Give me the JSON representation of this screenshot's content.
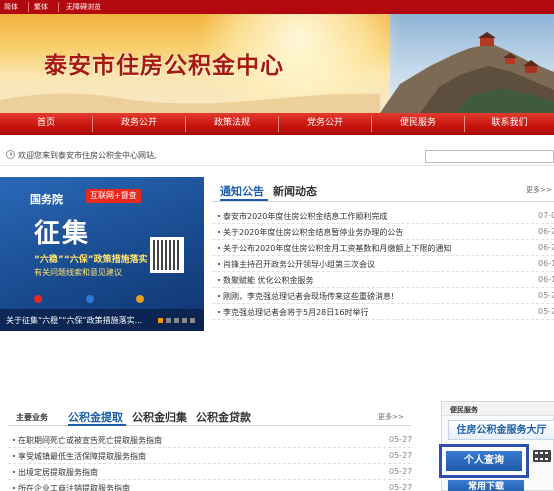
{
  "topbar": {
    "links": [
      "简体",
      "繁体",
      "无障碍浏览"
    ]
  },
  "banner": {
    "title": "泰安市住房公积金中心"
  },
  "nav": {
    "items": [
      "首页",
      "政务公开",
      "政策法规",
      "党务公开",
      "便民服务",
      "联系我们"
    ]
  },
  "welcome": {
    "text": "欢迎您来到泰安市住房公积金中心网站,"
  },
  "feature": {
    "gov_label": "国务院",
    "tag": "互联网+督查",
    "headline": "征集",
    "policy": "“六稳”“六保”政策措施落实",
    "subline": "有关问题线索和意见建议",
    "caption": "关于征集“六稳”“六保”政策措施落实..."
  },
  "notice": {
    "tabs": [
      "通知公告",
      "新闻动态"
    ],
    "more": "更多>>",
    "items": [
      {
        "title": "泰安市2020年度住房公积金结息工作顺利完成",
        "date": "07-0"
      },
      {
        "title": "关于2020年度住房公积金结息暂停业务办理的公告",
        "date": "06-2"
      },
      {
        "title": "关于公布2020年度住房公积金月工资基数和月缴额上下限的通知",
        "date": "06-2"
      },
      {
        "title": "肖锋主持召开政务公开领导小组第三次会议",
        "date": "06-1"
      },
      {
        "title": "数聚赋能 优化公积金服务",
        "date": "06-1"
      },
      {
        "title": "刚刚，李克强总理记者会现场传来这些重磅消息!",
        "date": "05-2"
      },
      {
        "title": "李克强总理记者会将于5月28日16时举行",
        "date": "05-2"
      }
    ]
  },
  "business": {
    "label": "主要业务",
    "tabs": [
      "公积金提取",
      "公积金归集",
      "公积金贷款"
    ],
    "more": "更多>>",
    "items": [
      {
        "title": "在职期间死亡或被宣告死亡提取服务指南",
        "date": "05-27"
      },
      {
        "title": "享受城镇最低生活保障提取服务指南",
        "date": "05-27"
      },
      {
        "title": "出境定居提取服务指南",
        "date": "05-27"
      },
      {
        "title": "所在企业工商注销提取服务指南",
        "date": "05-27"
      }
    ]
  },
  "service": {
    "head": "便民服务",
    "hall": "住房公积金服务大厅",
    "personal": "个人查询",
    "download": "常用下载"
  },
  "colors": {
    "brand_red": "#c9160f",
    "link_blue": "#1d5fa8",
    "highlight_border": "#2f4fae"
  }
}
